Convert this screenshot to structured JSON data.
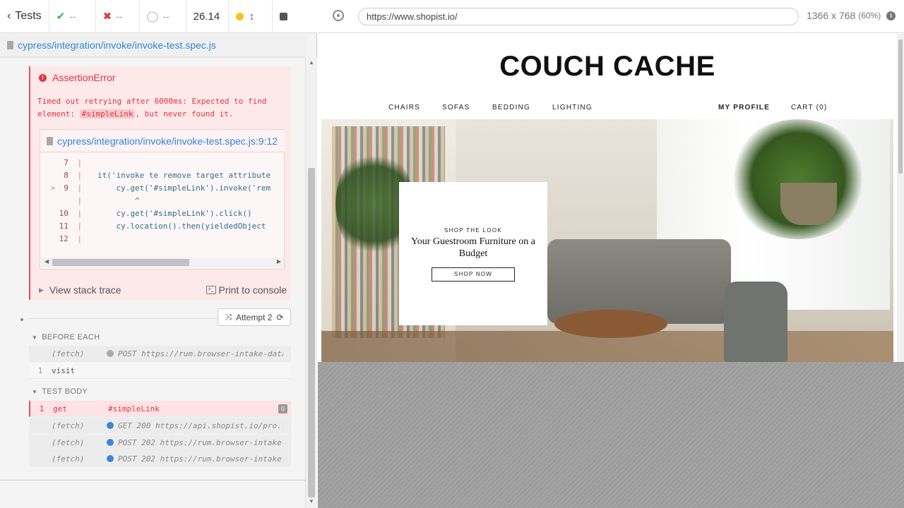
{
  "reporter": {
    "header": {
      "back_label": "Tests",
      "passed": "--",
      "failed": "--",
      "pending": "--",
      "duration": "26.14"
    },
    "spec_path": "cypress/integration/invoke/invoke-test.spec.js",
    "error": {
      "title": "AssertionError",
      "message_part1": "Timed out retrying after 6000ms: Expected to find element: ",
      "message_selector": "#simpleLink",
      "message_part2": ", but never found it.",
      "codeframe_path": "cypress/integration/invoke/invoke-test.spec.js:9:12",
      "code_lines": [
        {
          "num": "7",
          "marker": "",
          "src": ""
        },
        {
          "num": "8",
          "marker": "",
          "src": "  it('invoke te remove target attribute"
        },
        {
          "num": "9",
          "marker": ">",
          "src": "      cy.get('#simpleLink').invoke('rem"
        },
        {
          "num": "",
          "marker": "",
          "src": "          ^"
        },
        {
          "num": "10",
          "marker": "",
          "src": "      cy.get('#simpleLink').click()"
        },
        {
          "num": "11",
          "marker": "",
          "src": "      cy.location().then(yieldedObject"
        },
        {
          "num": "12",
          "marker": "",
          "src": ""
        }
      ],
      "stack_trace_label": "View stack trace",
      "print_console_label": "Print to console"
    },
    "attempt_label": "Attempt 2",
    "before_each": {
      "heading": "BEFORE EACH",
      "commands": [
        {
          "num": "",
          "name": "(fetch)",
          "message": "POST https://rum.browser-intake-datadoghq..."
        },
        {
          "num": "1",
          "name": "visit",
          "message": ""
        }
      ]
    },
    "test_body": {
      "heading": "TEST BODY",
      "commands": [
        {
          "num": "1",
          "name": "get",
          "message": "#simpleLink",
          "badge": "0"
        },
        {
          "num": "",
          "name": "(fetch)",
          "message": "GET 200 https://api.shopist.io/pro..."
        },
        {
          "num": "",
          "name": "(fetch)",
          "message": "POST 202 https://rum.browser-intake-datad..."
        },
        {
          "num": "",
          "name": "(fetch)",
          "message": "POST 202 https://rum.browser-intake-datad..."
        }
      ]
    }
  },
  "aut": {
    "url": "https://www.shopist.io/",
    "viewport": "1366 x 768",
    "scale": "(60%)",
    "site": {
      "brand": "COUCH CACHE",
      "nav_left": [
        "CHAIRS",
        "SOFAS",
        "BEDDING",
        "LIGHTING"
      ],
      "nav_profile": "MY PROFILE",
      "nav_cart": "CART (0)",
      "promo_kicker": "SHOP THE LOOK",
      "promo_headline": "Your Guestroom Furniture on a Budget",
      "promo_button": "SHOP NOW"
    }
  },
  "colors": {
    "pass": "#3fb54a",
    "fail": "#e3363c",
    "link": "#3386d4",
    "running": "#f7c21d"
  }
}
